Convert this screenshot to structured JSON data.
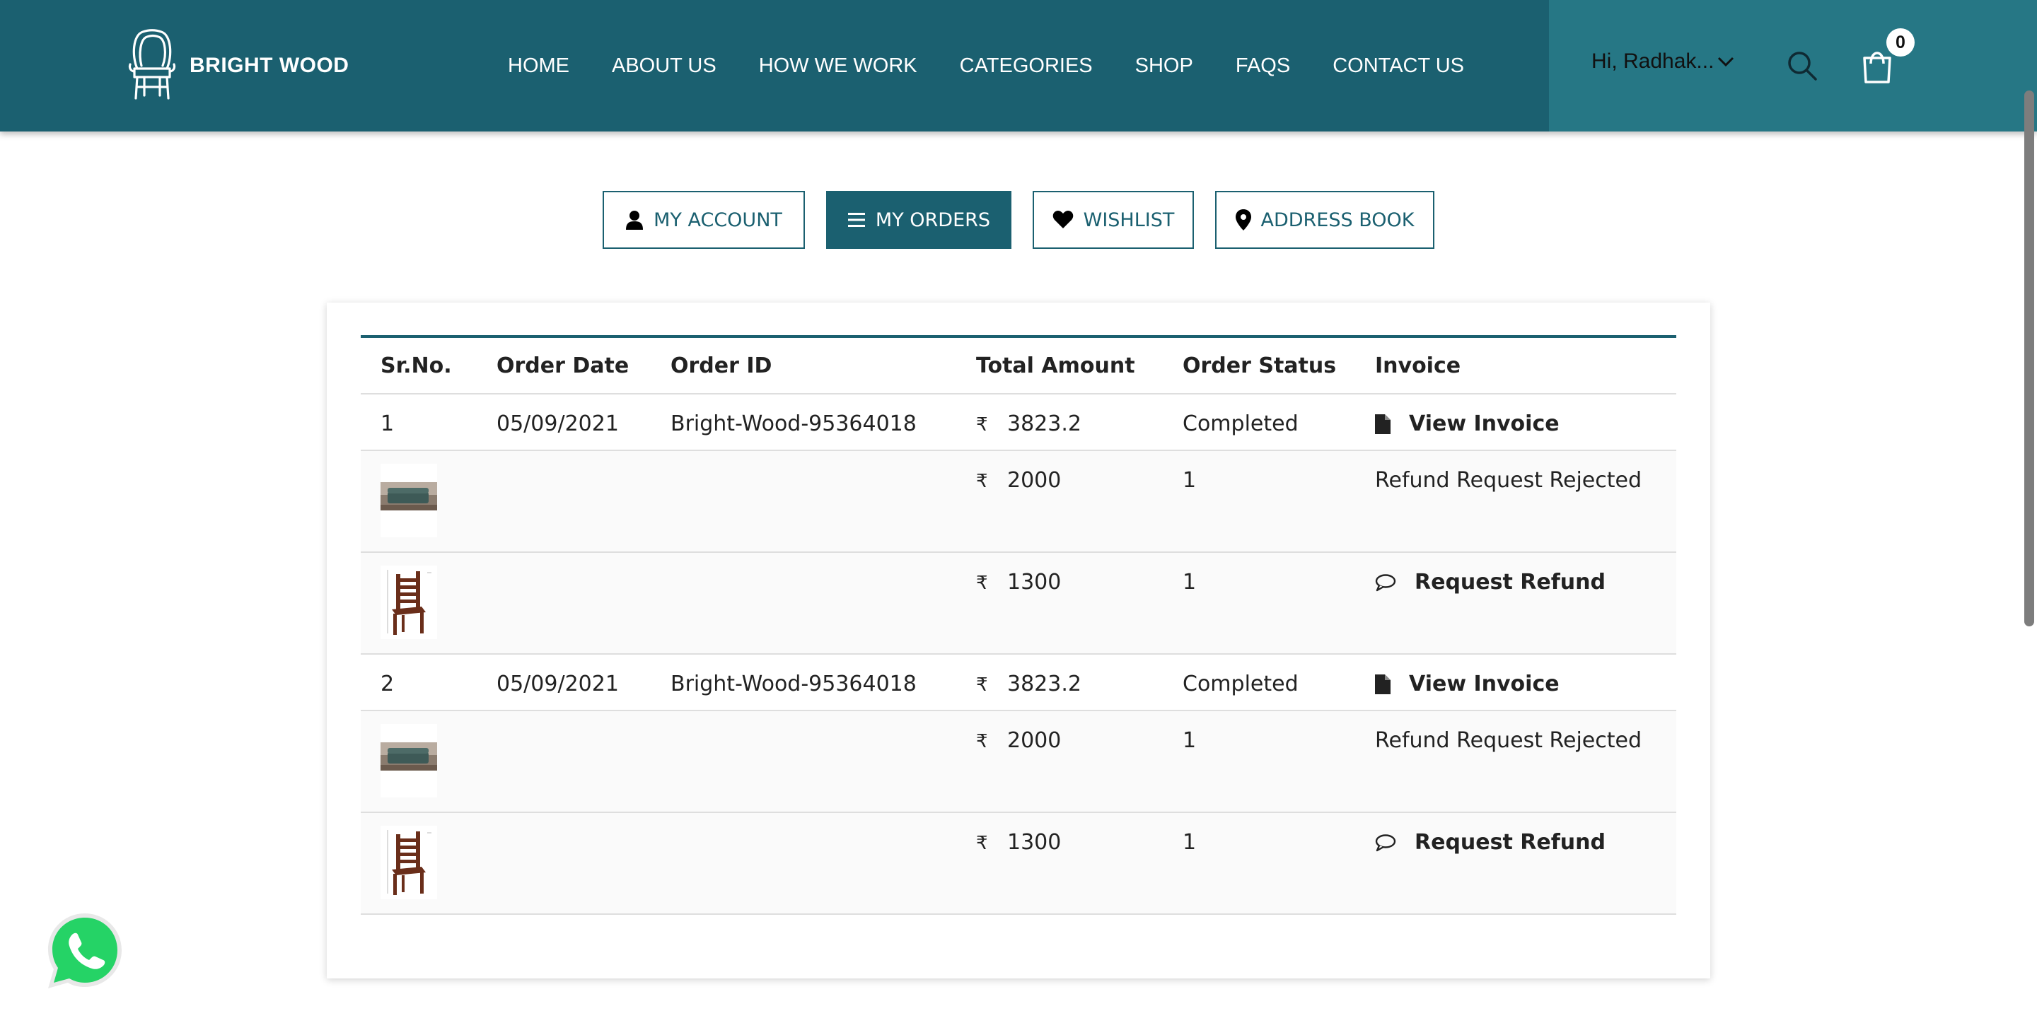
{
  "brand": {
    "name": "BRIGHT WOOD"
  },
  "nav": {
    "items": [
      "HOME",
      "ABOUT US",
      "HOW WE WORK",
      "CATEGORIES",
      "SHOP",
      "FAQS",
      "CONTACT US"
    ]
  },
  "user": {
    "greeting": "Hi, Radhak..."
  },
  "cart": {
    "count": "0"
  },
  "tabs": [
    {
      "label": "MY ACCOUNT",
      "icon": "user-icon",
      "active": false
    },
    {
      "label": "MY ORDERS",
      "icon": "list-icon",
      "active": true
    },
    {
      "label": "WISHLIST",
      "icon": "heart-icon",
      "active": false
    },
    {
      "label": "ADDRESS BOOK",
      "icon": "map-pin-icon",
      "active": false
    }
  ],
  "table": {
    "headers": [
      "Sr.No.",
      "Order Date",
      "Order ID",
      "Total Amount",
      "Order Status",
      "Invoice"
    ],
    "currency": "₹",
    "orders": [
      {
        "sr": "1",
        "date": "05/09/2021",
        "id": "Bright-Wood-95364018",
        "total": "3823.2",
        "status": "Completed",
        "invoice_label": "View Invoice",
        "items": [
          {
            "thumb": "sofa-image",
            "price": "2000",
            "qty": "1",
            "action": "Refund Request Rejected",
            "action_is_link": false
          },
          {
            "thumb": "chair-image",
            "price": "1300",
            "qty": "1",
            "action": "Request Refund",
            "action_is_link": true
          }
        ]
      },
      {
        "sr": "2",
        "date": "05/09/2021",
        "id": "Bright-Wood-95364018",
        "total": "3823.2",
        "status": "Completed",
        "invoice_label": "View Invoice",
        "items": [
          {
            "thumb": "sofa-image",
            "price": "2000",
            "qty": "1",
            "action": "Refund Request Rejected",
            "action_is_link": false
          },
          {
            "thumb": "chair-image",
            "price": "1300",
            "qty": "1",
            "action": "Request Refund",
            "action_is_link": true
          }
        ]
      }
    ]
  },
  "colors": {
    "primary": "#1b6070",
    "header_right": "#267785",
    "whatsapp": "#25d366"
  }
}
